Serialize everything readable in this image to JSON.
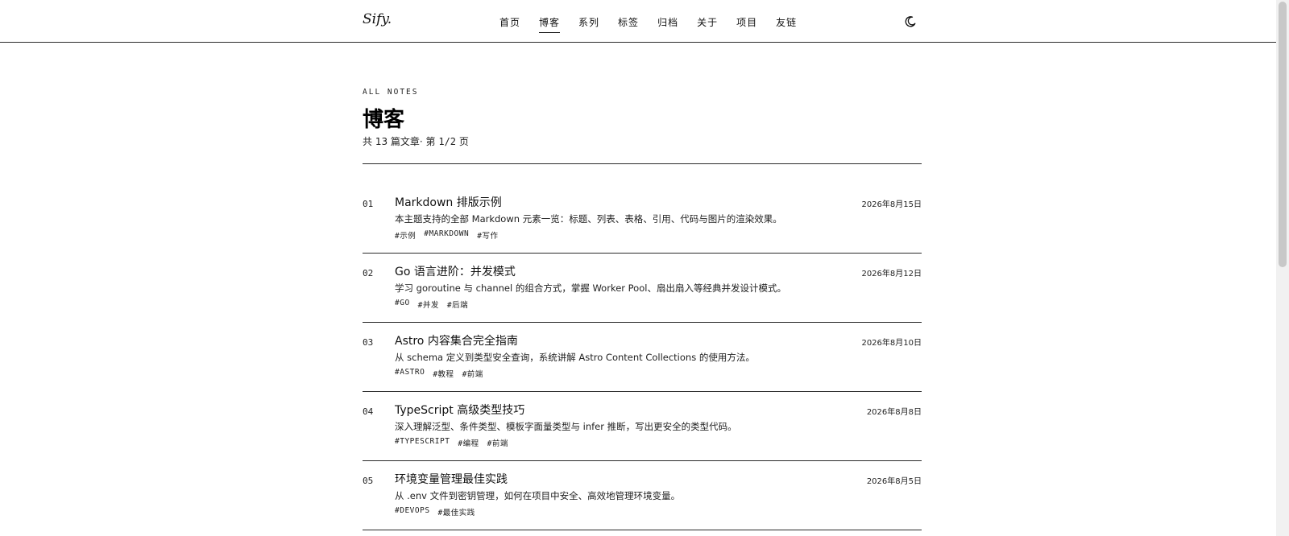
{
  "header": {
    "logo": "Sify.",
    "nav": [
      {
        "label": "首页",
        "active": false
      },
      {
        "label": "博客",
        "active": true
      },
      {
        "label": "系列",
        "active": false
      },
      {
        "label": "标签",
        "active": false
      },
      {
        "label": "归档",
        "active": false
      },
      {
        "label": "关于",
        "active": false
      },
      {
        "label": "项目",
        "active": false
      },
      {
        "label": "友链",
        "active": false
      }
    ],
    "theme_icon": "moon-icon"
  },
  "page": {
    "eyebrow": "ALL NOTES",
    "title": "博客",
    "meta_prefix": "共 13 篇文章· 第 ",
    "meta_page": "1/2",
    "meta_suffix": " 页"
  },
  "posts": [
    {
      "num": "01",
      "title": "Markdown 排版示例",
      "date": "2026年8月15日",
      "excerpt": "本主题支持的全部 Markdown 元素一览：标题、列表、表格、引用、代码与图片的渲染效果。",
      "tags": [
        "#示例",
        "#MARKDOWN",
        "#写作"
      ]
    },
    {
      "num": "02",
      "title": "Go 语言进阶：并发模式",
      "date": "2026年8月12日",
      "excerpt": "学习 goroutine 与 channel 的组合方式，掌握 Worker Pool、扇出扇入等经典并发设计模式。",
      "tags": [
        "#GO",
        "#并发",
        "#后端"
      ]
    },
    {
      "num": "03",
      "title": "Astro 内容集合完全指南",
      "date": "2026年8月10日",
      "excerpt": "从 schema 定义到类型安全查询，系统讲解 Astro Content Collections 的使用方法。",
      "tags": [
        "#ASTRO",
        "#教程",
        "#前端"
      ]
    },
    {
      "num": "04",
      "title": "TypeScript 高级类型技巧",
      "date": "2026年8月8日",
      "excerpt": "深入理解泛型、条件类型、模板字面量类型与 infer 推断，写出更安全的类型代码。",
      "tags": [
        "#TYPESCRIPT",
        "#编程",
        "#前端"
      ]
    },
    {
      "num": "05",
      "title": "环境变量管理最佳实践",
      "date": "2026年8月5日",
      "excerpt": "从 .env 文件到密钥管理，如何在项目中安全、高效地管理环境变量。",
      "tags": [
        "#DEVOPS",
        "#最佳实践"
      ]
    }
  ]
}
